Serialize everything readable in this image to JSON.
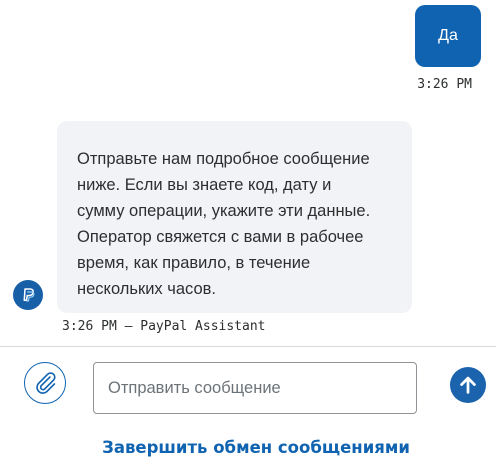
{
  "conversation": {
    "user_message": {
      "text": "Да",
      "time": "3:26 PM",
      "bubble_color": "#0f63b0"
    },
    "bot_message": {
      "lines": [
        "Отправьте нам подробное сообщение",
        "ниже. Если вы знаете код, дату и",
        "сумму операции, укажите эти данные.",
        "Оператор свяжется с вами в рабочее",
        "время, как правило, в течение",
        "нескольких часов."
      ],
      "meta": "3:26 PM – PayPal Assistant",
      "avatar_icon": "paypal-logo-icon"
    }
  },
  "composer": {
    "attach_icon": "paperclip-icon",
    "placeholder": "Отправить сообщение",
    "value": "",
    "send_icon": "arrow-up-icon"
  },
  "footer": {
    "end_chat_label": "Завершить обмен сообщениями"
  },
  "colors": {
    "accent": "#0f63b0",
    "bot_bubble": "#f2f3f6",
    "text": "#2c2e2f"
  }
}
